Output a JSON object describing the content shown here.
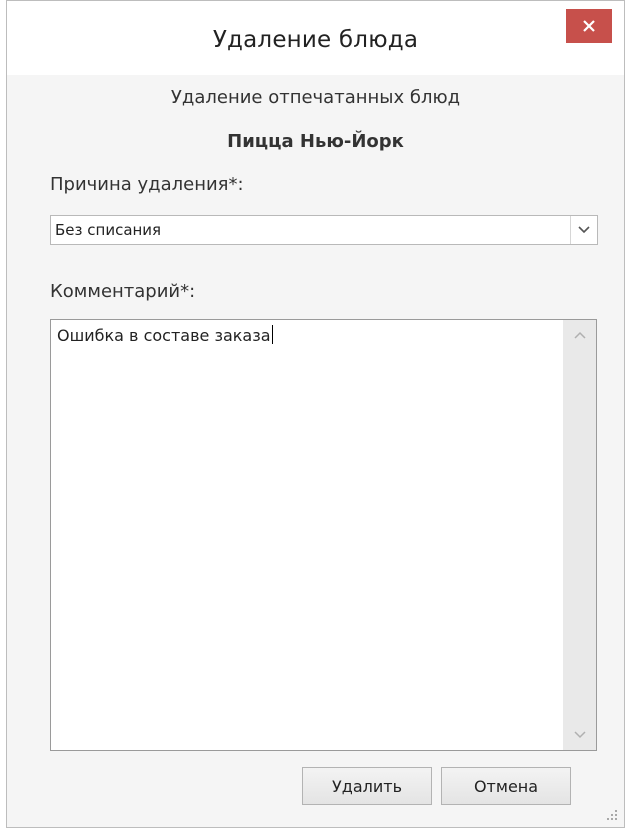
{
  "dialog": {
    "title": "Удаление блюда",
    "subtitle": "Удаление отпечатанных блюд",
    "dish_name": "Пицца Нью-Йорк"
  },
  "reason": {
    "label": "Причина удаления*:",
    "selected": "Без списания"
  },
  "comment": {
    "label": "Комментарий*:",
    "value": "Ошибка в составе заказа"
  },
  "buttons": {
    "delete_label": "Удалить",
    "cancel_label": "Отмена"
  },
  "icons": {
    "close": "close-icon",
    "dropdown": "chevron-down-icon",
    "scroll_up": "chevron-up-icon",
    "scroll_down": "chevron-down-icon",
    "grip": "resize-grip-icon"
  },
  "colors": {
    "close_button": "#c7504b",
    "window_background": "#f5f5f5"
  }
}
